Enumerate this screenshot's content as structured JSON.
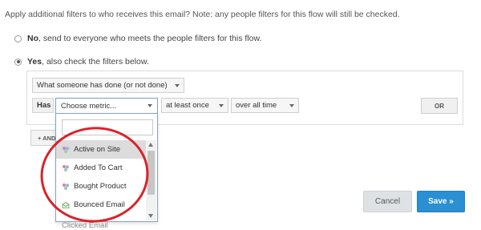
{
  "question": "Apply additional filters to who receives this email? Note: any people filters for this flow will still be checked.",
  "options": [
    {
      "bold": "No",
      "text": ", send to everyone who meets the people filters for this flow.",
      "checked": false
    },
    {
      "bold": "Yes",
      "text": ", also check the filters below.",
      "checked": true
    }
  ],
  "condition": {
    "type_select": "What someone has done (or not done)",
    "has_label": "Has",
    "metric_placeholder": "Choose metric...",
    "frequency_select": "at least once",
    "timeframe_select": "over all time",
    "or_button": "OR"
  },
  "add_button": "+ AND",
  "dropdown": {
    "search_value": "",
    "items": [
      {
        "label": "Active on Site",
        "icon": "metric-icon",
        "highlighted": true
      },
      {
        "label": "Added To Cart",
        "icon": "metric-icon",
        "highlighted": false
      },
      {
        "label": "Bought Product",
        "icon": "metric-icon",
        "highlighted": false
      },
      {
        "label": "Bounced Email",
        "icon": "email-icon",
        "highlighted": false
      },
      {
        "label": "Clicked Email",
        "icon": "email-icon",
        "highlighted": false
      }
    ]
  },
  "annotation_color": "#d9232a",
  "footer": {
    "cancel": "Cancel",
    "save": "Save »"
  }
}
